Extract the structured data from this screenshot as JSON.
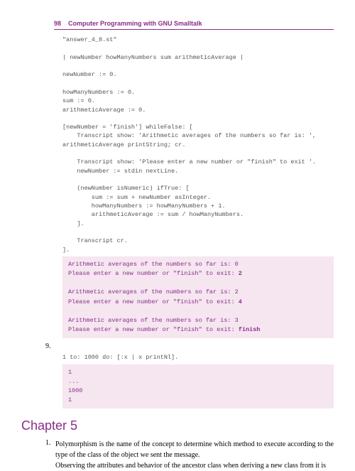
{
  "header": {
    "page_number": "98",
    "title": "Computer Programming with GNU Smalltalk"
  },
  "code1": "\"answer_4_8.st\"\n\n| newNumber howManyNumbers sum arithmeticAverage |\n\nnewNumber := 0.\n\nhowManyNumbers := 0.\nsum := 0.\narithmeticAverage := 0.\n\n[newNumber = 'finish'] whileFalse: [\n    Transcript show: 'Arithmetic averages of the numbers so far is: ',\narithmeticAverage printString; cr.\n\n    Transcript show: 'Please enter a new number or \"finish\" to exit '.\n    newNumber := stdin nextLine.\n\n    (newNumber isNumeric) ifTrue: [\n        sum := sum + newNumber asInteger.\n        howManyNumbers := howManyNumbers + 1.\n        arithmeticAverage := sum / howManyNumbers.\n    ].\n\n    Transcript cr.\n].",
  "output1": {
    "line1": "Arithmetic averages of the numbers so far is: 0",
    "line2a": "Please enter a new number or \"finish\" to exit: ",
    "line2b": "2",
    "blank1": "",
    "line3": "Arithmetic averages of the numbers so far is: 2",
    "line4a": "Please enter a new number or \"finish\" to exit: ",
    "line4b": "4",
    "blank2": "",
    "line5": "Arithmetic averages of the numbers so far is: 3",
    "line6a": "Please enter a new number or \"finish\" to exit: ",
    "line6b": "finish"
  },
  "list_marker_9": "9.",
  "code2": "1 to: 1000 do: [:x | x printNl].",
  "output2": "1\n...\n1000\n1",
  "chapter": {
    "heading": "Chapter 5",
    "item1_num": "1.",
    "item1_text": "Polymorphism is the name of the concept to determine which method to execute according to the type of the class of the object we sent the message.",
    "para2": "Observing the attributes and behavior of the ancestor class when deriving a new class from it is"
  }
}
